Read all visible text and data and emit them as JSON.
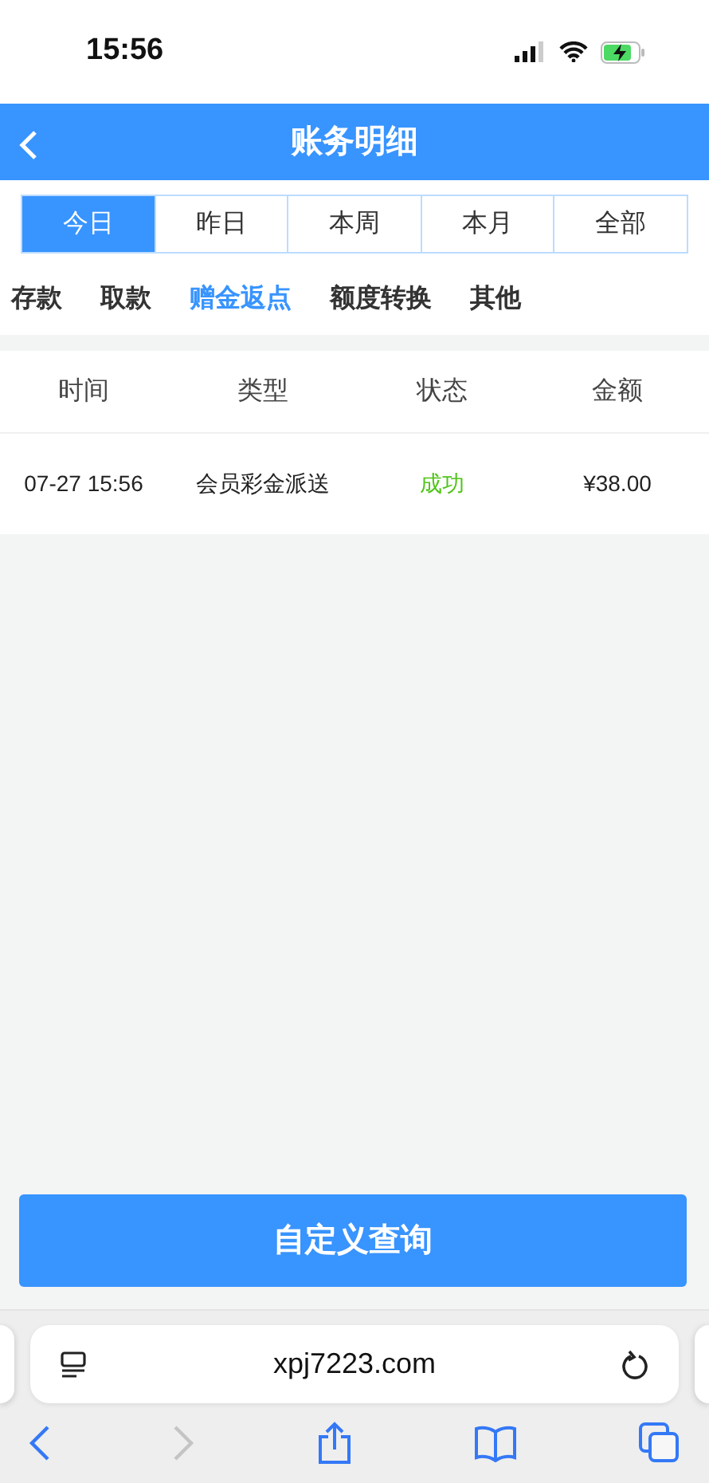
{
  "status_bar": {
    "time": "15:56"
  },
  "header": {
    "title": "账务明细"
  },
  "periods": [
    {
      "label": "今日",
      "selected": true
    },
    {
      "label": "昨日",
      "selected": false
    },
    {
      "label": "本周",
      "selected": false
    },
    {
      "label": "本月",
      "selected": false
    },
    {
      "label": "全部",
      "selected": false
    }
  ],
  "categories": [
    {
      "label": "存款",
      "selected": false
    },
    {
      "label": "取款",
      "selected": false
    },
    {
      "label": "赠金返点",
      "selected": true
    },
    {
      "label": "额度转换",
      "selected": false
    },
    {
      "label": "其他",
      "selected": false
    }
  ],
  "table": {
    "columns": [
      "时间",
      "类型",
      "状态",
      "金额"
    ],
    "rows": [
      {
        "time": "07-27 15:56",
        "type": "会员彩金派送",
        "status": "成功",
        "succeeded": true,
        "amount": "¥38.00"
      }
    ]
  },
  "query_button": "自定义查询",
  "browser": {
    "url": "xpj7223.com",
    "forward_disabled": true
  }
}
